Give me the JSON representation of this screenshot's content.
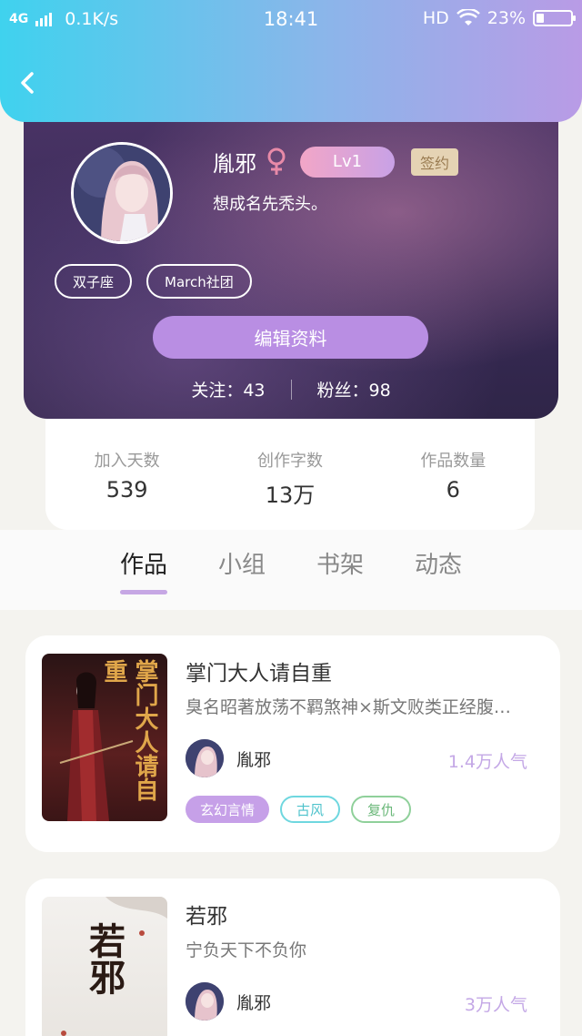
{
  "status_bar": {
    "network": "4G",
    "speed": "0.1K/s",
    "time": "18:41",
    "hd": "HD",
    "battery": "23%",
    "battery_level": 0.23
  },
  "profile": {
    "username": "胤邪",
    "level": "Lv1",
    "signed_label": "签约",
    "bio": "想成名先秃头。",
    "tags": [
      "双子座",
      "March社团"
    ],
    "edit_button": "编辑资料",
    "follow_label": "关注：43",
    "fans_label": "粉丝：98"
  },
  "stats": [
    {
      "label": "加入天数",
      "value": "539"
    },
    {
      "label": "创作字数",
      "value": "13万"
    },
    {
      "label": "作品数量",
      "value": "6"
    }
  ],
  "tabs": [
    {
      "label": "作品",
      "active": true
    },
    {
      "label": "小组",
      "active": false
    },
    {
      "label": "书架",
      "active": false
    },
    {
      "label": "动态",
      "active": false
    }
  ],
  "works": [
    {
      "title": "掌门大人请自重",
      "desc": "臭名昭著放荡不羁煞神×斯文败类正经腹…",
      "author": "胤邪",
      "popularity": "1.4万人气",
      "tags": [
        "玄幻言情",
        "古风",
        "复仇"
      ],
      "cover_text": "掌门大人请自重"
    },
    {
      "title": "若邪",
      "desc": "宁负天下不负你",
      "author": "胤邪",
      "popularity": "3万人气",
      "tags": [],
      "cover_text": "若邪"
    }
  ],
  "colors": {
    "header_gradient_start": "#3fd2ee",
    "header_gradient_end": "#b99be6",
    "accent_purple": "#b98ee3",
    "popularity": "#c4a8e6"
  }
}
